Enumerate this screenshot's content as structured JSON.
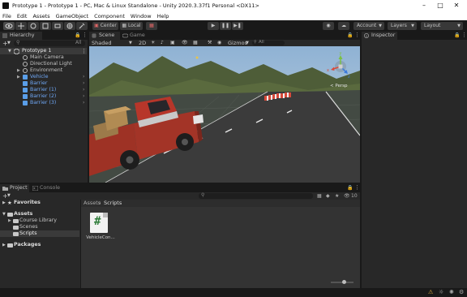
{
  "window": {
    "title": "Prototype 1 - Prototype 1 - PC, Mac & Linux Standalone - Unity 2020.3.37f1 Personal <DX11>"
  },
  "menu": [
    "File",
    "Edit",
    "Assets",
    "GameObject",
    "Component",
    "Window",
    "Help"
  ],
  "toolbar": {
    "center_label": "Center",
    "local_label": "Local",
    "account_label": "Account",
    "layers_label": "Layers",
    "layout_label": "Layout"
  },
  "hierarchy": {
    "tab_label": "Hierarchy",
    "search_placeholder": "All",
    "scene_name": "Prototype 1",
    "items": [
      {
        "label": "Main Camera",
        "prefab": false
      },
      {
        "label": "Directional Light",
        "prefab": false
      },
      {
        "label": "Environment",
        "prefab": false
      },
      {
        "label": "Vehicle",
        "prefab": true
      },
      {
        "label": "Barrier",
        "prefab": true
      },
      {
        "label": "Barrier (1)",
        "prefab": true
      },
      {
        "label": "Barrier (2)",
        "prefab": true
      },
      {
        "label": "Barrier (3)",
        "prefab": true
      }
    ]
  },
  "scene": {
    "scene_tab": "Scene",
    "game_tab": "Game",
    "shading_mode": "Shaded",
    "mode_2d": "2D",
    "gizmos_label": "Gizmos",
    "gizmos_search": "All",
    "persp_label": "< Persp",
    "axis_y": "y",
    "axis_x": "x",
    "axis_z": "z"
  },
  "inspector": {
    "tab_label": "Inspector"
  },
  "project": {
    "project_tab": "Project",
    "console_tab": "Console",
    "favorites_label": "Favorites",
    "assets_label": "Assets",
    "assets_children": [
      "Course Library",
      "Scenes",
      "Scripts"
    ],
    "packages_label": "Packages",
    "breadcrumb_root": "Assets",
    "breadcrumb_sep": "›",
    "breadcrumb_current": "Scripts",
    "hidden_count": "10",
    "files": [
      {
        "name": "VehicleCon...",
        "type": "C# script"
      }
    ]
  },
  "colors": {
    "accent_blue": "#2c5d87",
    "prefab_blue": "#6fa7f5",
    "panel_bg": "#282828",
    "dark_bg": "#191919",
    "sky": "#a7c2dc",
    "hills": "#4d5c37",
    "road": "#3b3b3b",
    "truck_red": "#b23b2e",
    "script_green": "#2f7d3a"
  }
}
